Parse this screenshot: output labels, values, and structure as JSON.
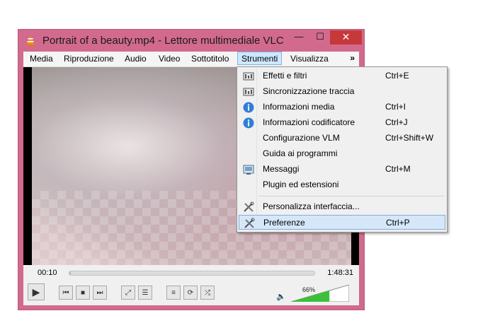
{
  "window": {
    "title": "Portrait of a beauty.mp4 - Lettore multimediale VLC",
    "minimize_label": "—",
    "maximize_label": "☐",
    "close_label": "✕"
  },
  "menubar": {
    "items": [
      "Media",
      "Riproduzione",
      "Audio",
      "Video",
      "Sottotitolo",
      "Strumenti",
      "Visualizza"
    ],
    "active": "Strumenti",
    "overflow_label": "»"
  },
  "strumenti_menu": {
    "items": [
      {
        "label": "Effetti e filtri",
        "shortcut": "Ctrl+E",
        "icon": "equalizer-icon"
      },
      {
        "label": "Sincronizzazione traccia",
        "shortcut": "",
        "icon": "equalizer-icon"
      },
      {
        "label": "Informazioni media",
        "shortcut": "Ctrl+I",
        "icon": "info-icon"
      },
      {
        "label": "Informazioni codificatore",
        "shortcut": "Ctrl+J",
        "icon": "info-icon"
      },
      {
        "label": "Configurazione VLM",
        "shortcut": "Ctrl+Shift+W",
        "icon": ""
      },
      {
        "label": "Guida ai programmi",
        "shortcut": "",
        "icon": ""
      },
      {
        "label": "Messaggi",
        "shortcut": "Ctrl+M",
        "icon": "messages-icon"
      },
      {
        "label": "Plugin ed estensioni",
        "shortcut": "",
        "icon": ""
      },
      {
        "label": "Personalizza interfaccia...",
        "shortcut": "",
        "icon": "tools-icon"
      },
      {
        "label": "Preferenze",
        "shortcut": "Ctrl+P",
        "icon": "tools-icon"
      }
    ],
    "highlighted": "Preferenze"
  },
  "player": {
    "time_current": "00:10",
    "time_total": "1:48:31",
    "progress_fraction": 0.0015,
    "volume_label": "66%",
    "volume_fraction": 0.66
  },
  "colors": {
    "window_frame": "#d26a8e",
    "close_button": "#c7383a",
    "menu_highlight": "#d5e7f8",
    "volume_fill": "#3cbf3c"
  }
}
